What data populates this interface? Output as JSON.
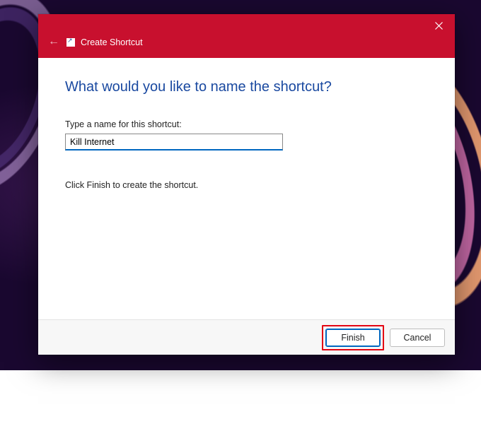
{
  "titlebar": {
    "title": "Create Shortcut"
  },
  "content": {
    "heading": "What would you like to name the shortcut?",
    "field_label": "Type a name for this shortcut:",
    "shortcut_name": "Kill Internet",
    "instruction": "Click Finish to create the shortcut."
  },
  "footer": {
    "finish_label": "Finish",
    "cancel_label": "Cancel"
  }
}
